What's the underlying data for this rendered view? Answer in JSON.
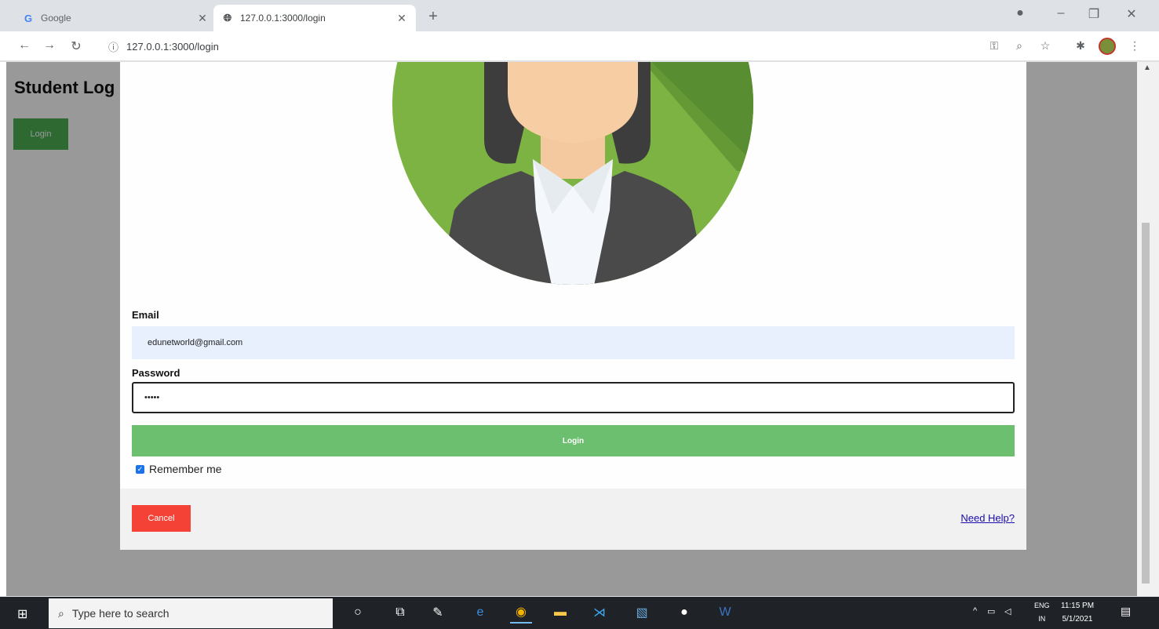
{
  "browser": {
    "tabs": [
      {
        "title": "Google",
        "active": false
      },
      {
        "title": "127.0.0.1:3000/login",
        "active": true
      }
    ],
    "url": "127.0.0.1:3000/login"
  },
  "page": {
    "title": "Student Log",
    "login_button": "Login"
  },
  "modal": {
    "email_label": "Email",
    "email_value": "edunetworld@gmail.com",
    "password_label": "Password",
    "password_value": "•••••",
    "login_button": "Login",
    "remember_label": "Remember me",
    "remember_checked": true,
    "cancel_button": "Cancel",
    "help_link": "Need Help?"
  },
  "taskbar": {
    "search_placeholder": "Type here to search",
    "lang_line1": "ENG",
    "lang_line2": "IN",
    "time": "11:15 PM",
    "date": "5/1/2021"
  },
  "colors": {
    "green_button": "#6cbf6f",
    "cancel_red": "#f44336",
    "page_login_green": "#4caf50"
  }
}
